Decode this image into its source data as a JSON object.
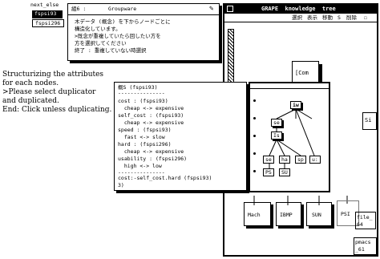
{
  "menu": {
    "title": "next_else",
    "items": [
      "fspsi93",
      "fspsi296"
    ]
  },
  "message_window": {
    "title_text": "Groupware",
    "label_prefix": "組6 :",
    "lines": [
      "木データ (概念) を下からノードごとに",
      "構造化しています。",
      ">既念が重複していたら回したい方を",
      "方を選択してください",
      "終了 : 重複していない時選択"
    ]
  },
  "tree_window": {
    "title": "GRAPE  knowledge  tree",
    "toolbar": [
      "選択",
      "表示",
      "移動",
      "S",
      "削除",
      "☐"
    ],
    "root_label": "[Com",
    "side_label": "Si",
    "nodes_top": [
      "iw"
    ],
    "nodes_mid": [
      "se",
      "Is"
    ],
    "nodes_row": [
      "se",
      "ha",
      "sp",
      "u:"
    ],
    "nodes_bottom": [
      "PS",
      "SU"
    ],
    "bottom_nodes": [
      "Mach",
      "IBMP",
      "SUN",
      "PSI"
    ],
    "file_items": [
      "file_ 64",
      "pmacs _61"
    ]
  },
  "attr_window": {
    "title": "概S (fspsi93)",
    "lines": [
      "cost : (fspsi93)",
      "  cheap <-> expensive",
      "self_cost : (fspsi93)",
      "  cheap <-> expensive",
      "speed : (fspsi93)",
      "  fast <-> slow",
      "hard : (fspsi296)",
      "  cheap <-> expensive",
      "usability : (fspsi296)",
      "  high <-> low",
      "",
      "cost:-self_cost.hard (fspsi93)",
      "3)"
    ]
  },
  "annotation": {
    "lines": [
      "Structurizing the attributes",
      "for each nodes.",
      ">Please select duplicator",
      "and duplicated.",
      "End: Click unless duplicating."
    ]
  }
}
